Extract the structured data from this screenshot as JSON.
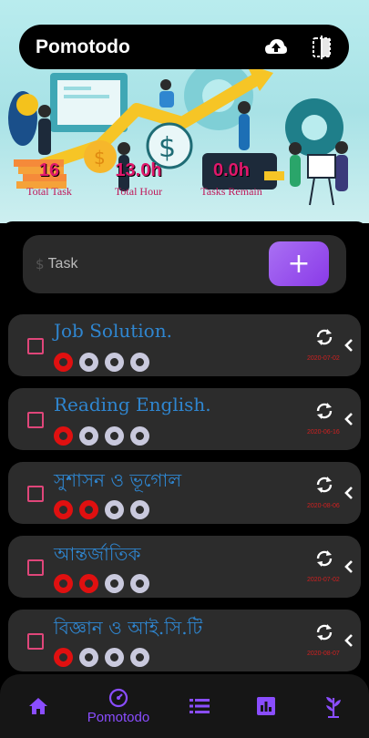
{
  "app": {
    "title": "Pomotodo"
  },
  "stats": [
    {
      "value": "16",
      "label": "Total Task"
    },
    {
      "value": "13.0h",
      "label": "Total Hour"
    },
    {
      "value": "0.0h",
      "label": "Tasks Remain"
    }
  ],
  "task_input": {
    "prefix": "$",
    "placeholder": "Task",
    "add_label": "+"
  },
  "tasks": [
    {
      "name": "Job Solution.",
      "date": "2020-07-02",
      "pomodoros_done": 1,
      "pomodoros_total": 4
    },
    {
      "name": "Reading English.",
      "date": "2020-06-16",
      "pomodoros_done": 1,
      "pomodoros_total": 4
    },
    {
      "name": "সুশাসন ও ভূগোল",
      "date": "2020-08-06",
      "pomodoros_done": 2,
      "pomodoros_total": 4
    },
    {
      "name": "আন্তর্জাতিক",
      "date": "2020-07-02",
      "pomodoros_done": 2,
      "pomodoros_total": 4
    },
    {
      "name": "বিজ্ঞান ও আই.সি.টি",
      "date": "2020-08-07",
      "pomodoros_done": 1,
      "pomodoros_total": 4
    }
  ],
  "nav": {
    "active_label": "Pomotodo",
    "items": [
      "home-icon",
      "timer-icon",
      "list-icon",
      "chart-icon",
      "plant-icon"
    ]
  },
  "colors": {
    "accent": "#8a4dff",
    "checkbox": "#e0467a",
    "task_name": "#2f86d0",
    "dot_done": "#e01010",
    "dot_todo": "#c9c9dd"
  }
}
